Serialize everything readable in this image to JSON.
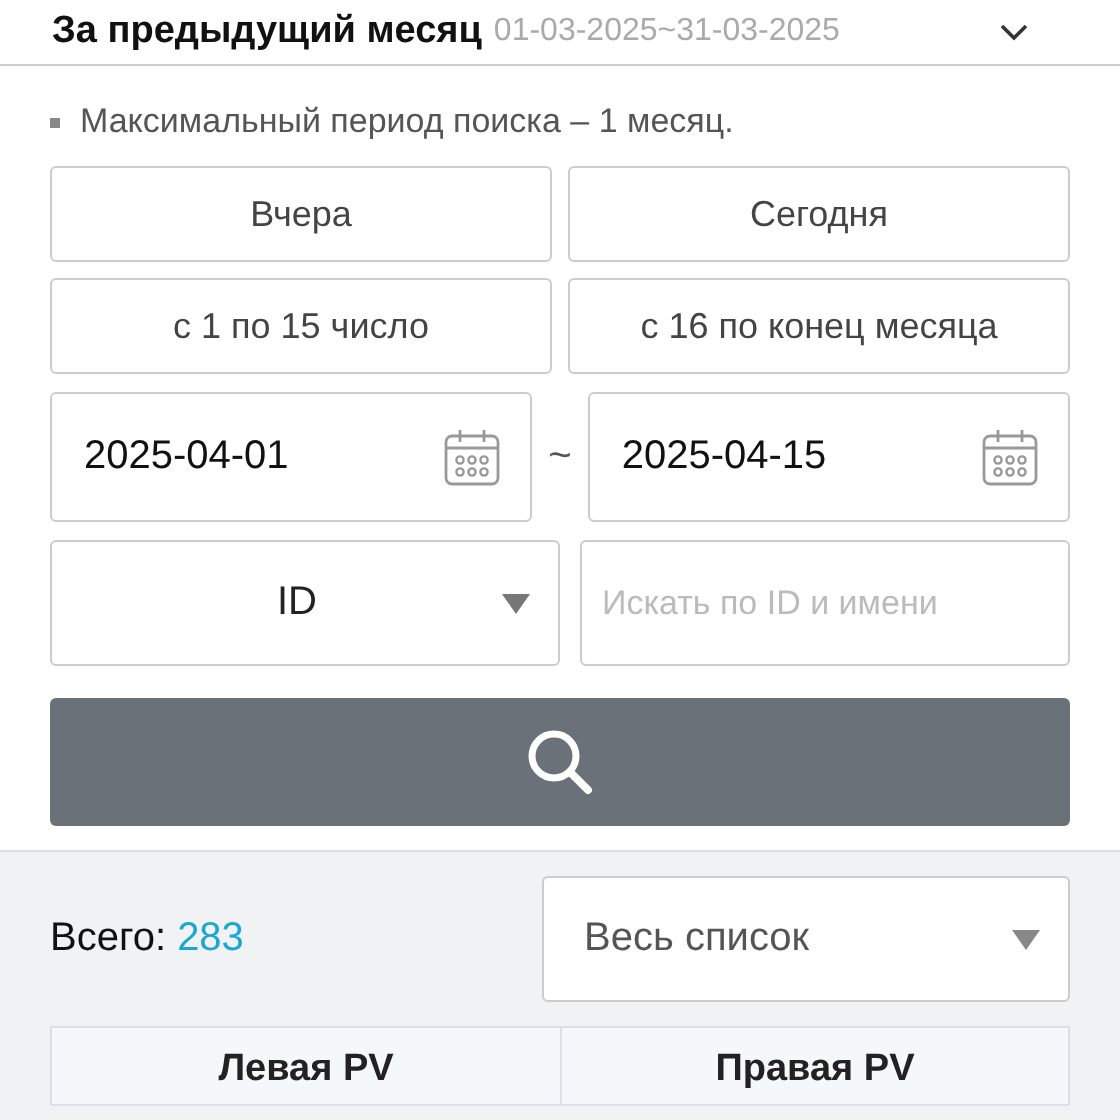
{
  "period": {
    "title": "За предыдущий месяц",
    "range": "01-03-2025~31-03-2025",
    "expanded": false
  },
  "note": "Максимальный период поиска – 1 месяц.",
  "quick_ranges": [
    {
      "label": "Вчера"
    },
    {
      "label": "Сегодня"
    },
    {
      "label": "с 1 по 15 число"
    },
    {
      "label": "с 16 по конец месяца"
    }
  ],
  "date_from": "2025-04-01",
  "separator": "~",
  "date_to": "2025-04-15",
  "search_type": "ID",
  "search_field": {
    "placeholder": "Искать по ID и имени"
  },
  "total": {
    "label": "Всего:",
    "value": "283"
  },
  "filter": "Весь список",
  "table": {
    "columns": [
      "Левая PV",
      "Правая PV"
    ]
  }
}
